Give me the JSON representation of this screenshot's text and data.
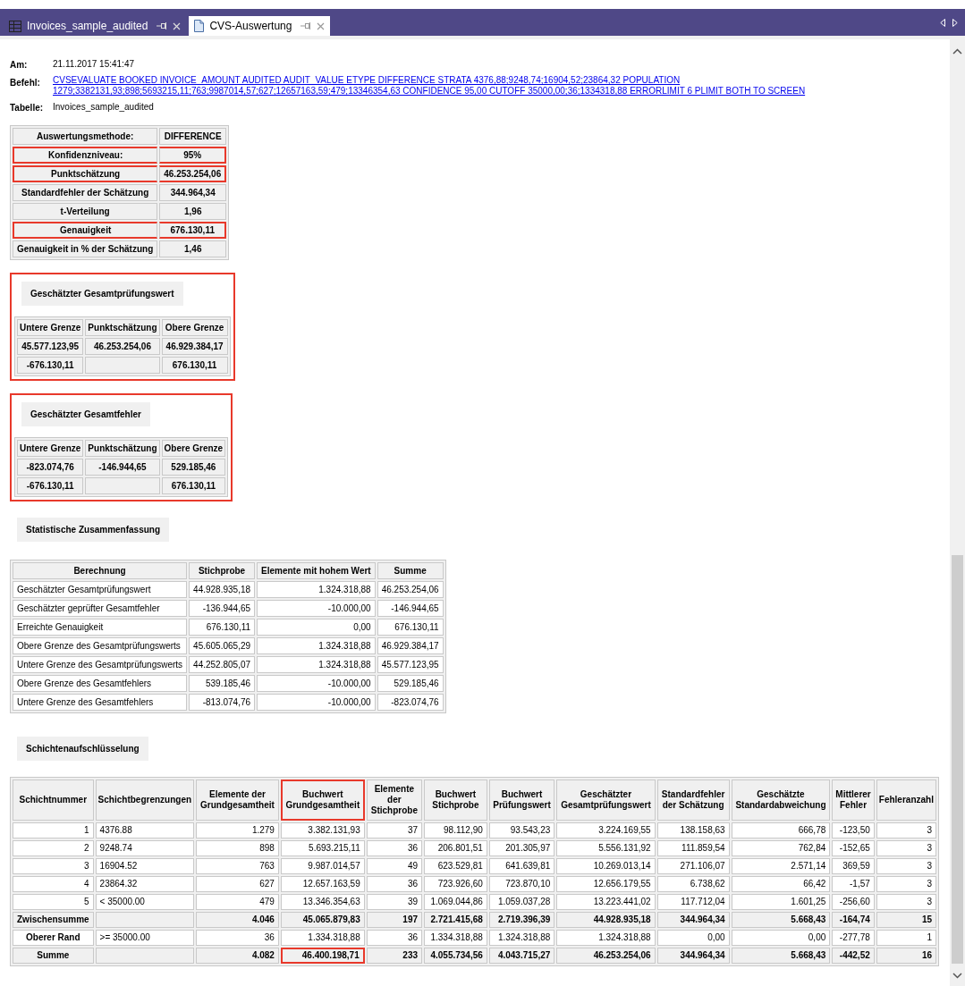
{
  "tabs": [
    {
      "label": "Invoices_sample_audited",
      "kind": "table",
      "selected": false
    },
    {
      "label": "CVS-Auswertung",
      "kind": "document",
      "selected": true
    }
  ],
  "header": {
    "fields": [
      {
        "label": "Am:",
        "value": "21.11.2017 15:41:47",
        "kind": "text"
      },
      {
        "label": "Befehl:",
        "value": "CVSEVALUATE BOOKED INVOICE_AMOUNT AUDITED AUDIT_VALUE ETYPE DIFFERENCE STRATA 4376,88;9248,74;16904,52;23864,32 POPULATION 1279;3382131,93;898;5693215,11;763;9987014,57;627;12657163,59;479;13346354,63 CONFIDENCE 95,00 CUTOFF 35000,00;36;1334318,88 ERRORLIMIT 6 PLIMIT BOTH TO SCREEN",
        "kind": "link"
      },
      {
        "label": "Tabelle:",
        "value": "Invoices_sample_audited",
        "kind": "text"
      }
    ]
  },
  "method_table": {
    "rows": [
      {
        "label": "Auswertungsmethode:",
        "value": "DIFFERENCE",
        "highlighted": false
      },
      {
        "label": "Konfidenzniveau:",
        "value": "95%",
        "highlighted": true
      },
      {
        "label": "Punktschätzung",
        "value": "46.253.254,06",
        "highlighted": true
      },
      {
        "label": "Standardfehler der Schätzung",
        "value": "344.964,34",
        "highlighted": false
      },
      {
        "label": "t-Verteilung",
        "value": "1,96",
        "highlighted": false
      },
      {
        "label": "Genauigkeit",
        "value": "676.130,11",
        "highlighted": true
      },
      {
        "label": "Genauigkeit in % der Schätzung",
        "value": "1,46",
        "highlighted": false
      }
    ]
  },
  "estimate_sections": [
    {
      "title": "Geschätzter Gesamtprüfungswert",
      "highlighted": true,
      "columns": [
        "Untere Grenze",
        "Punktschätzung",
        "Obere Grenze"
      ],
      "rows": [
        [
          "45.577.123,95",
          "46.253.254,06",
          "46.929.384,17"
        ],
        [
          "-676.130,11",
          "",
          "676.130,11"
        ]
      ]
    },
    {
      "title": "Geschätzter Gesamtfehler",
      "highlighted": true,
      "columns": [
        "Untere Grenze",
        "Punktschätzung",
        "Obere Grenze"
      ],
      "rows": [
        [
          "-823.074,76",
          "-146.944,65",
          "529.185,46"
        ],
        [
          "-676.130,11",
          "",
          "676.130,11"
        ]
      ]
    }
  ],
  "summary": {
    "title": "Statistische Zusammenfassung",
    "columns": [
      "Berechnung",
      "Stichprobe",
      "Elemente mit hohem Wert",
      "Summe"
    ],
    "rows": [
      [
        "Geschätzter Gesamtprüfungswert",
        "44.928.935,18",
        "1.324.318,88",
        "46.253.254,06"
      ],
      [
        "Geschätzter geprüfter Gesamtfehler",
        "-136.944,65",
        "-10.000,00",
        "-146.944,65"
      ],
      [
        "Erreichte Genauigkeit",
        "676.130,11",
        "0,00",
        "676.130,11"
      ],
      [
        "Obere Grenze des Gesamtprüfungswerts",
        "45.605.065,29",
        "1.324.318,88",
        "46.929.384,17"
      ],
      [
        "Untere Grenze des Gesamtprüfungswerts",
        "44.252.805,07",
        "1.324.318,88",
        "45.577.123,95"
      ],
      [
        "Obere Grenze des Gesamtfehlers",
        "539.185,46",
        "-10.000,00",
        "529.185,46"
      ],
      [
        "Untere Grenze des Gesamtfehlers",
        "-813.074,76",
        "-10.000,00",
        "-823.074,76"
      ]
    ]
  },
  "strata": {
    "title": "Schichtenaufschlüsselung",
    "columns": [
      {
        "label": "Schichtnummer",
        "highlighted": false
      },
      {
        "label": "Schichtbegrenzungen",
        "highlighted": false
      },
      {
        "label": "Elemente der Grundgesamtheit",
        "highlighted": false
      },
      {
        "label": "Buchwert Grundgesamtheit",
        "highlighted": true
      },
      {
        "label": "Elemente der Stichprobe",
        "highlighted": false
      },
      {
        "label": "Buchwert Stichprobe",
        "highlighted": false
      },
      {
        "label": "Buchwert Prüfungswert",
        "highlighted": false
      },
      {
        "label": "Geschätzter Gesamtprüfungswert",
        "highlighted": false
      },
      {
        "label": "Standardfehler der Schätzung",
        "highlighted": false
      },
      {
        "label": "Geschätzte Standardabweichung",
        "highlighted": false
      },
      {
        "label": "Mittlerer Fehler",
        "highlighted": false
      },
      {
        "label": "Fehleranzahl",
        "highlighted": false
      }
    ],
    "rows": [
      {
        "kind": "stratum",
        "cells": [
          "1",
          "4376.88",
          "1.279",
          "3.382.131,93",
          "37",
          "98.112,90",
          "93.543,23",
          "3.224.169,55",
          "138.158,63",
          "666,78",
          "-123,50",
          "3"
        ]
      },
      {
        "kind": "stratum",
        "cells": [
          "2",
          "9248.74",
          "898",
          "5.693.215,11",
          "36",
          "206.801,51",
          "201.305,97",
          "5.556.131,92",
          "111.859,54",
          "762,84",
          "-152,65",
          "3"
        ]
      },
      {
        "kind": "stratum",
        "cells": [
          "3",
          "16904.52",
          "763",
          "9.987.014,57",
          "49",
          "623.529,81",
          "641.639,81",
          "10.269.013,14",
          "271.106,07",
          "2.571,14",
          "369,59",
          "3"
        ]
      },
      {
        "kind": "stratum",
        "cells": [
          "4",
          "23864.32",
          "627",
          "12.657.163,59",
          "36",
          "723.926,60",
          "723.870,10",
          "12.656.179,55",
          "6.738,62",
          "66,42",
          "-1,57",
          "3"
        ]
      },
      {
        "kind": "stratum",
        "cells": [
          "5",
          "< 35000.00",
          "479",
          "13.346.354,63",
          "39",
          "1.069.044,86",
          "1.059.037,28",
          "13.223.441,02",
          "117.712,04",
          "1.601,25",
          "-256,60",
          "3"
        ]
      },
      {
        "kind": "subtotal",
        "cells": [
          "Zwischensumme",
          "",
          "4.046",
          "45.065.879,83",
          "197",
          "2.721.415,68",
          "2.719.396,39",
          "44.928.935,18",
          "344.964,34",
          "5.668,43",
          "-164,74",
          "15"
        ]
      },
      {
        "kind": "upper",
        "cells": [
          "Oberer Rand",
          ">= 35000.00",
          "36",
          "1.334.318,88",
          "36",
          "1.334.318,88",
          "1.324.318,88",
          "1.324.318,88",
          "0,00",
          "0,00",
          "-277,78",
          "1"
        ]
      },
      {
        "kind": "total",
        "cells": [
          "Summe",
          "",
          "4.082",
          {
            "text": "46.400.198,71",
            "highlighted": true
          },
          "233",
          "4.055.734,56",
          "4.043.715,27",
          "46.253.254,06",
          "344.964,34",
          "5.668,43",
          "-442,52",
          "16"
        ]
      }
    ]
  }
}
